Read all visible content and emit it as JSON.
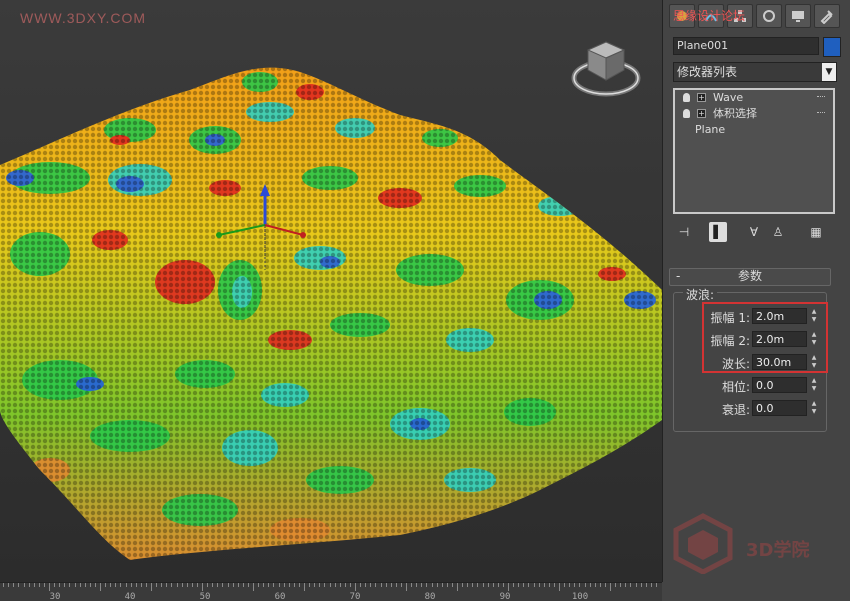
{
  "watermark_top": "WWW.3DXY.COM",
  "tab_watermark": "思缘设计论坛",
  "object": {
    "name": "Plane001",
    "color": "#1f5fbf"
  },
  "modifier_list": {
    "label": "修改器列表"
  },
  "modifier_stack": [
    {
      "label": "Wave",
      "has_bulb": true,
      "expandable": true
    },
    {
      "label": "体积选择",
      "has_bulb": true,
      "expandable": true
    },
    {
      "label": "Plane",
      "has_bulb": false,
      "expandable": false
    }
  ],
  "parameters": {
    "header": "参数",
    "collapse_glyph": "-",
    "group_title": "波浪:",
    "fields": [
      {
        "label": "振幅 1:",
        "value": "2.0m"
      },
      {
        "label": "振幅 2:",
        "value": "2.0m"
      },
      {
        "label": "波长:",
        "value": "30.0m"
      },
      {
        "label": "相位:",
        "value": "0.0"
      },
      {
        "label": "衰退:",
        "value": "0.0"
      }
    ]
  },
  "ruler": {
    "labels": [
      "30",
      "40",
      "50",
      "60",
      "70",
      "80",
      "90",
      "100"
    ]
  },
  "logo_text": "3D学院",
  "colors": {
    "highlight": "#d33333",
    "accent": "#1f5fbf"
  },
  "icons": [
    "create-icon",
    "modify-icon",
    "hierarchy-icon",
    "motion-icon",
    "display-icon",
    "utilities-icon",
    "pin-stack-icon",
    "show-end-result-icon",
    "make-unique-icon",
    "remove-modifier-icon",
    "configure-sets-icon",
    "light-bulb-icon"
  ]
}
